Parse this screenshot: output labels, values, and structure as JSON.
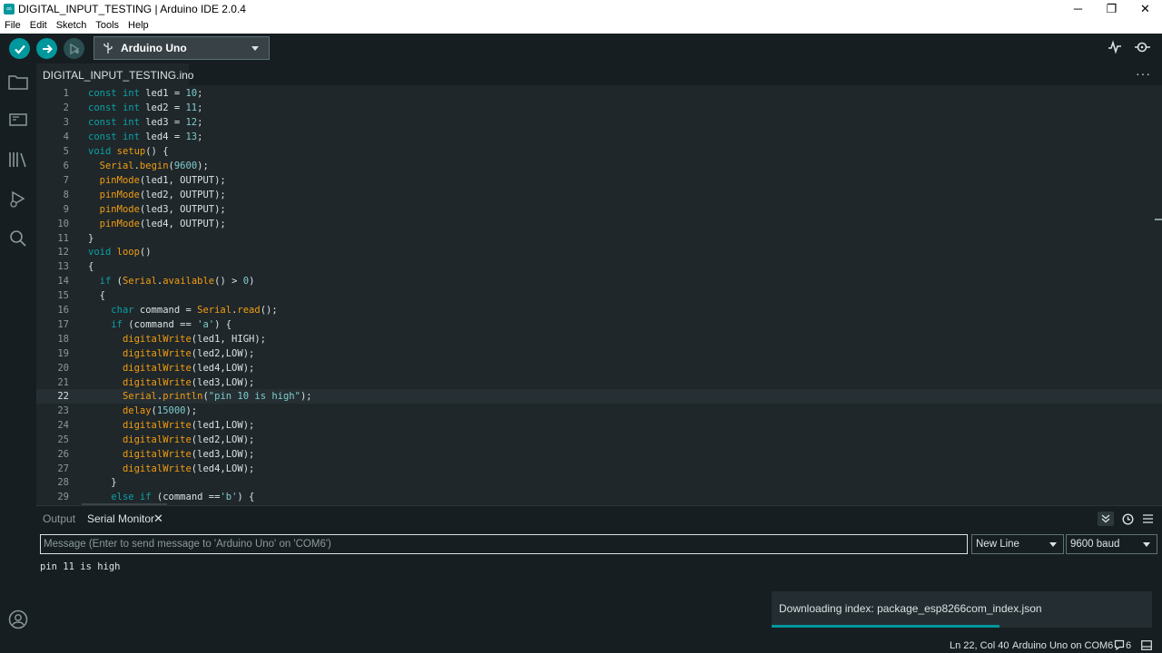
{
  "window": {
    "title": "DIGITAL_INPUT_TESTING | Arduino IDE 2.0.4",
    "controls": [
      "─",
      "❐",
      "✕"
    ]
  },
  "menu": [
    "File",
    "Edit",
    "Sketch",
    "Tools",
    "Help"
  ],
  "toolbar": {
    "board": "Arduino Uno",
    "buttons": [
      "verify-icon",
      "upload-icon",
      "debug-icon"
    ],
    "right_icons": [
      "serial-plotter-icon",
      "serial-monitor-icon"
    ]
  },
  "sidebar": {
    "icons": [
      "sketchbook-folder-icon",
      "boards-manager-icon",
      "library-manager-icon",
      "debug-run-icon",
      "search-icon",
      "profile-icon"
    ]
  },
  "editor": {
    "tab": "DIGITAL_INPUT_TESTING.ino",
    "more": "···",
    "active_line": 22,
    "lines": [
      "1",
      "2",
      "3",
      "4",
      "5",
      "6",
      "7",
      "8",
      "9",
      "10",
      "11",
      "12",
      "13",
      "14",
      "15",
      "16",
      "17",
      "18",
      "19",
      "20",
      "21",
      "22",
      "23",
      "24",
      "25",
      "26",
      "27",
      "28",
      "29"
    ]
  },
  "panel": {
    "tabs": [
      "Output",
      "Serial Monitor"
    ],
    "close": "✕",
    "message_placeholder": "Message (Enter to send message to 'Arduino Uno' on 'COM6')",
    "line_ending": "New Line",
    "baud": "9600 baud",
    "output": "pin 11 is high"
  },
  "toast": {
    "message": "Downloading index: package_esp8266com_index.json",
    "progress": 0.6
  },
  "status": {
    "cursor": "Ln 22, Col 40",
    "board_port": "Arduino Uno on COM6",
    "notifications": "6"
  },
  "colors": {
    "accent": "#00979d",
    "keyword": "#0ca1a6",
    "function": "#f39c12",
    "literal": "#7fcbcd",
    "text": "#dae3e3"
  }
}
